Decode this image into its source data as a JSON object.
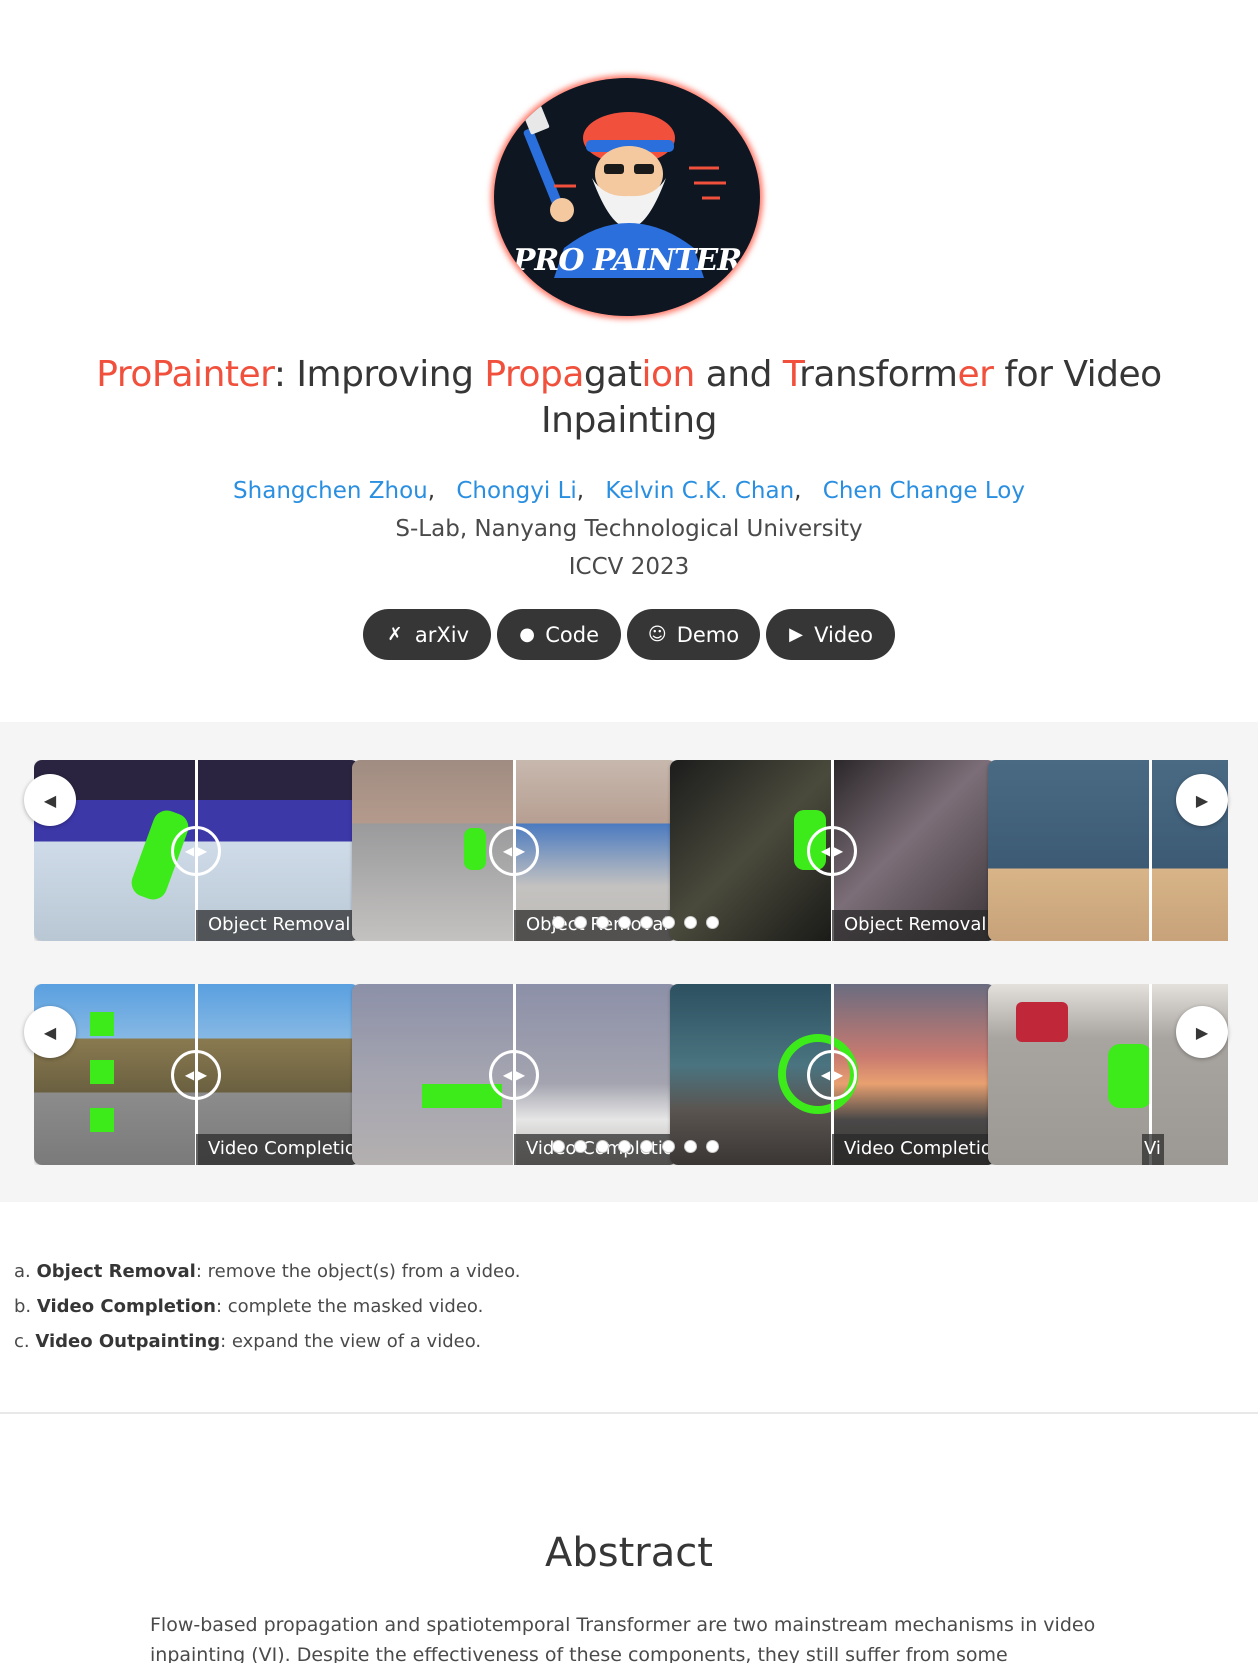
{
  "logo": {
    "text": "PRO PAINTER"
  },
  "title": {
    "parts": [
      {
        "t": "ProPainter",
        "hl": true
      },
      {
        "t": ": Improving ",
        "hl": false
      },
      {
        "t": "Propa",
        "hl": true
      },
      {
        "t": "gat",
        "hl": false
      },
      {
        "t": "io",
        "hl": true
      },
      {
        "t": "n",
        "hl": true
      },
      {
        "t": " and ",
        "hl": false
      },
      {
        "t": "T",
        "hl": true
      },
      {
        "t": "ransform",
        "hl": false
      },
      {
        "t": "er",
        "hl": true
      },
      {
        "t": " for Video Inpainting",
        "hl": false
      }
    ]
  },
  "authors": [
    "Shangchen Zhou",
    "Chongyi Li",
    "Kelvin C.K. Chan",
    "Chen Change Loy"
  ],
  "affiliation": "S-Lab, Nanyang Technological University",
  "venue": "ICCV 2023",
  "links": [
    {
      "label": "arXiv",
      "icon": "arxiv-icon",
      "glyph": "✗"
    },
    {
      "label": "Code",
      "icon": "github-icon",
      "glyph": "●"
    },
    {
      "label": "Demo",
      "icon": "huggingface-icon",
      "glyph": "☺"
    },
    {
      "label": "Video",
      "icon": "youtube-icon",
      "glyph": "▶"
    }
  ],
  "carousel_row1": {
    "cards": [
      {
        "label": "Object Removal"
      },
      {
        "label": "Object Removal"
      },
      {
        "label": "Object Removal"
      },
      {
        "label": ""
      }
    ]
  },
  "carousel_row2": {
    "cards": [
      {
        "label": "Video Completion"
      },
      {
        "label": "Video Completion"
      },
      {
        "label": "Video Completion"
      },
      {
        "label": "Vi"
      }
    ]
  },
  "tasks": [
    {
      "marker": "a.",
      "name": "Object Removal",
      "desc": ": remove the object(s) from a video."
    },
    {
      "marker": "b.",
      "name": "Video Completion",
      "desc": ": complete the masked video."
    },
    {
      "marker": "c.",
      "name": "Video Outpainting",
      "desc": ": expand the view of a video."
    }
  ],
  "abstract": {
    "heading": "Abstract",
    "text": "Flow-based propagation and spatiotemporal Transformer are two mainstream mechanisms in video inpainting (VI). Despite the effectiveness of these components, they still suffer from some limitations"
  }
}
